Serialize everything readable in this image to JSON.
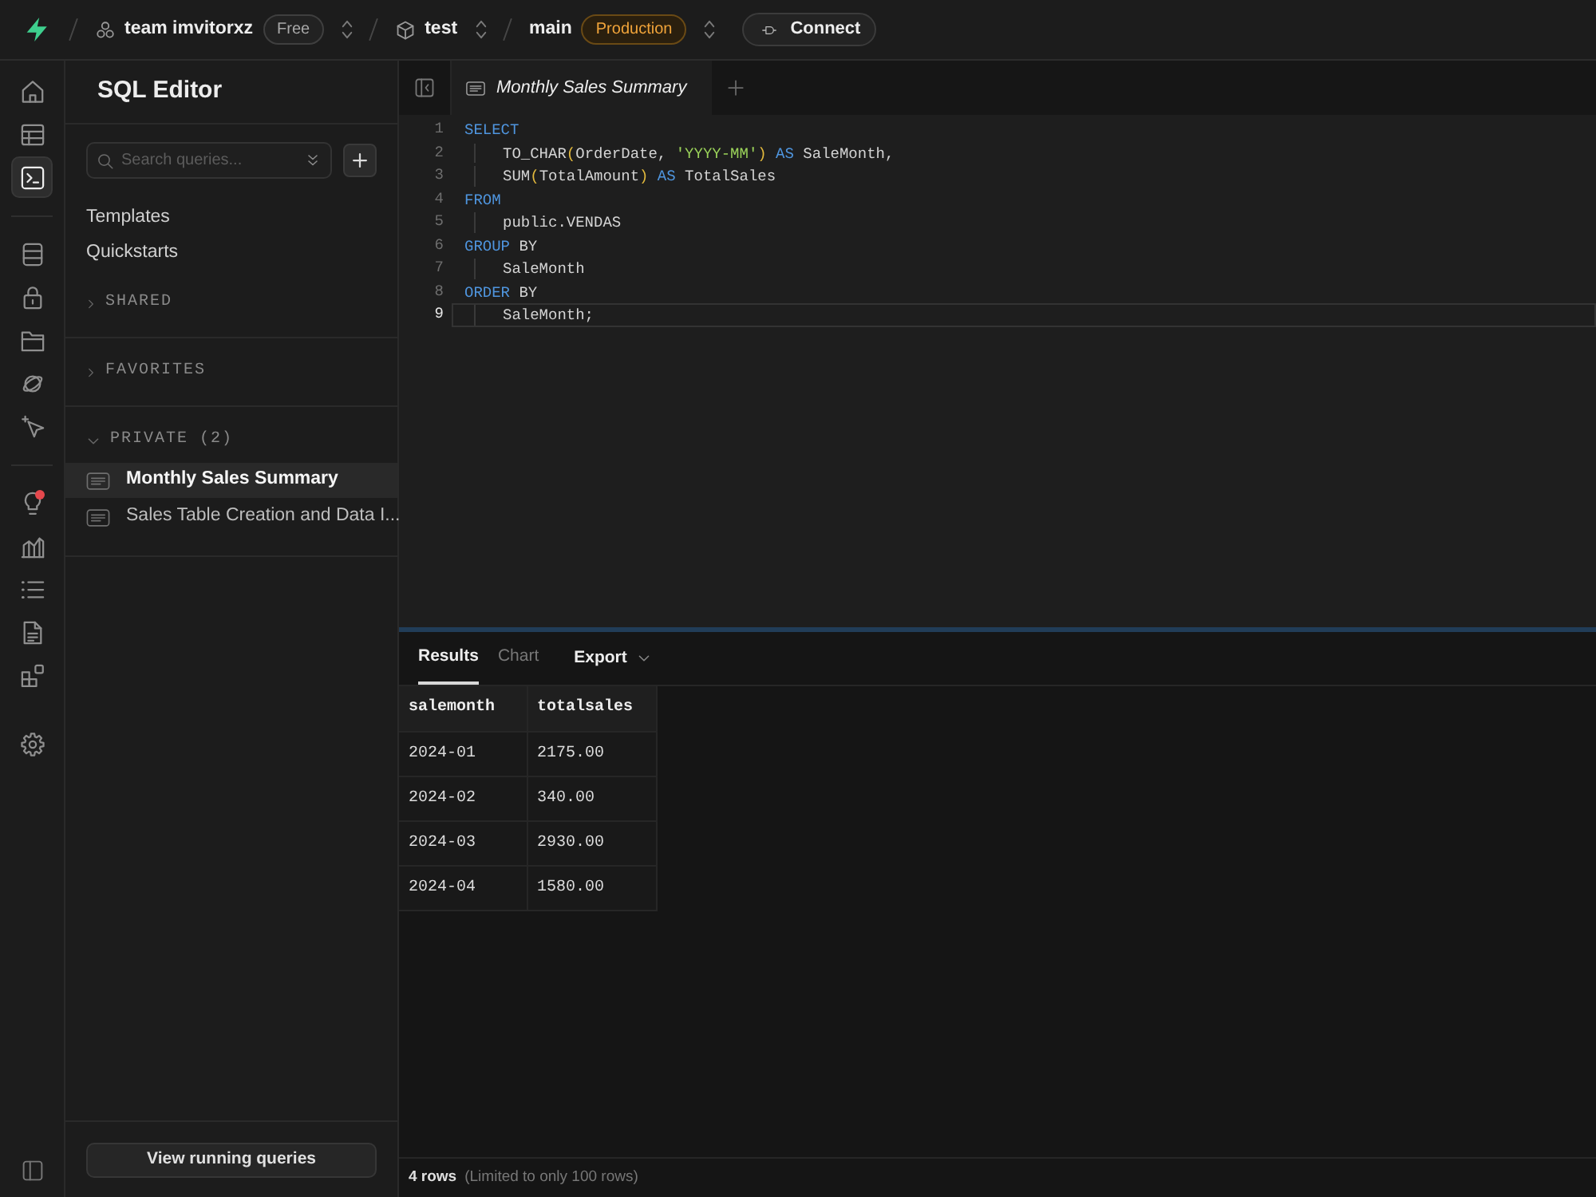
{
  "topbar": {
    "breadcrumbs": [
      {
        "kind": "organization",
        "label": "team imvitorxz",
        "badge": {
          "text": "Free",
          "kind": "plain"
        }
      },
      {
        "kind": "project",
        "label": "test"
      },
      {
        "kind": "branch",
        "label": "main",
        "badge": {
          "text": "Production",
          "kind": "warning"
        }
      }
    ],
    "connect_button": "Connect"
  },
  "rail": {
    "groups": [
      [
        {
          "selected": false,
          "notification": false
        },
        {
          "selected": false,
          "notification": false
        },
        {
          "selected": true,
          "notification": false
        }
      ],
      [
        {
          "selected": false,
          "notification": false
        },
        {
          "selected": false,
          "notification": false
        },
        {
          "selected": false,
          "notification": false
        },
        {
          "selected": false,
          "notification": false
        },
        {
          "selected": false,
          "notification": false
        }
      ],
      [
        {
          "selected": false,
          "notification": true
        },
        {
          "selected": false,
          "notification": false
        },
        {
          "selected": false,
          "notification": false
        },
        {
          "selected": false,
          "notification": false
        },
        {
          "selected": false,
          "notification": false
        }
      ],
      [
        {
          "selected": false,
          "notification": false
        }
      ]
    ]
  },
  "sidebar": {
    "title": "SQL Editor",
    "search": {
      "placeholder": "Search queries..."
    },
    "links": [
      "Templates",
      "Quickstarts"
    ],
    "sections": [
      {
        "label": "SHARED",
        "expanded": false
      },
      {
        "label": "FAVORITES",
        "expanded": false
      },
      {
        "label": "PRIVATE (2)",
        "expanded": true,
        "items": [
          {
            "label": "Monthly Sales Summary",
            "selected": true
          },
          {
            "label": "Sales Table Creation and Data I...",
            "selected": false
          }
        ]
      }
    ],
    "footer_button": "View running queries"
  },
  "editor": {
    "tabs": [
      {
        "label": "Monthly Sales Summary",
        "selected": true
      }
    ],
    "lines": [
      {
        "number": "1",
        "selected": false,
        "tokens": [
          {
            "kind": "keyword",
            "text": "SELECT"
          }
        ],
        "children": [
          {
            "number": "2",
            "selected": false,
            "tokens": [
              {
                "kind": "plain",
                "text": "TO_CHAR"
              },
              {
                "kind": "bracket",
                "text": "("
              },
              {
                "kind": "plain",
                "text": "OrderDate, "
              },
              {
                "kind": "string",
                "text": "'YYYY-MM'"
              },
              {
                "kind": "bracket",
                "text": ")"
              },
              {
                "kind": "keyword",
                "text": " AS"
              },
              {
                "kind": "plain",
                "text": " SaleMonth,"
              }
            ]
          },
          {
            "number": "3",
            "selected": false,
            "tokens": [
              {
                "kind": "plain",
                "text": "SUM"
              },
              {
                "kind": "bracket",
                "text": "("
              },
              {
                "kind": "plain",
                "text": "TotalAmount"
              },
              {
                "kind": "bracket",
                "text": ")"
              },
              {
                "kind": "keyword",
                "text": " AS"
              },
              {
                "kind": "plain",
                "text": " TotalSales"
              }
            ]
          }
        ]
      },
      {
        "number": "4",
        "selected": false,
        "tokens": [
          {
            "kind": "keyword",
            "text": "FROM"
          }
        ],
        "children": [
          {
            "number": "5",
            "selected": false,
            "tokens": [
              {
                "kind": "plain",
                "text": "public.VENDAS"
              }
            ]
          }
        ]
      },
      {
        "number": "6",
        "selected": false,
        "tokens": [
          {
            "kind": "keyword",
            "text": "GROUP"
          },
          {
            "kind": "plain",
            "text": " BY"
          }
        ],
        "children": [
          {
            "number": "7",
            "selected": false,
            "tokens": [
              {
                "kind": "plain",
                "text": "SaleMonth"
              }
            ]
          }
        ]
      },
      {
        "number": "8",
        "selected": false,
        "tokens": [
          {
            "kind": "keyword",
            "text": "ORDER"
          },
          {
            "kind": "plain",
            "text": " BY"
          }
        ],
        "children": [
          {
            "number": "9",
            "selected": true,
            "tokens": [
              {
                "kind": "plain",
                "text": "SaleMonth;"
              }
            ]
          }
        ]
      }
    ]
  },
  "results": {
    "tabs": [
      {
        "label": "Results",
        "selected": true
      },
      {
        "label": "Chart",
        "selected": false
      }
    ],
    "export_button": "Export",
    "table": {
      "columns": [
        "salemonth",
        "totalsales"
      ],
      "rows": [
        [
          "2024-01",
          "2175.00"
        ],
        [
          "2024-02",
          "340.00"
        ],
        [
          "2024-03",
          "2930.00"
        ],
        [
          "2024-04",
          "1580.00"
        ]
      ]
    },
    "footer": {
      "row_count": "4 rows",
      "note": "(Limited to only 100 rows)"
    }
  }
}
